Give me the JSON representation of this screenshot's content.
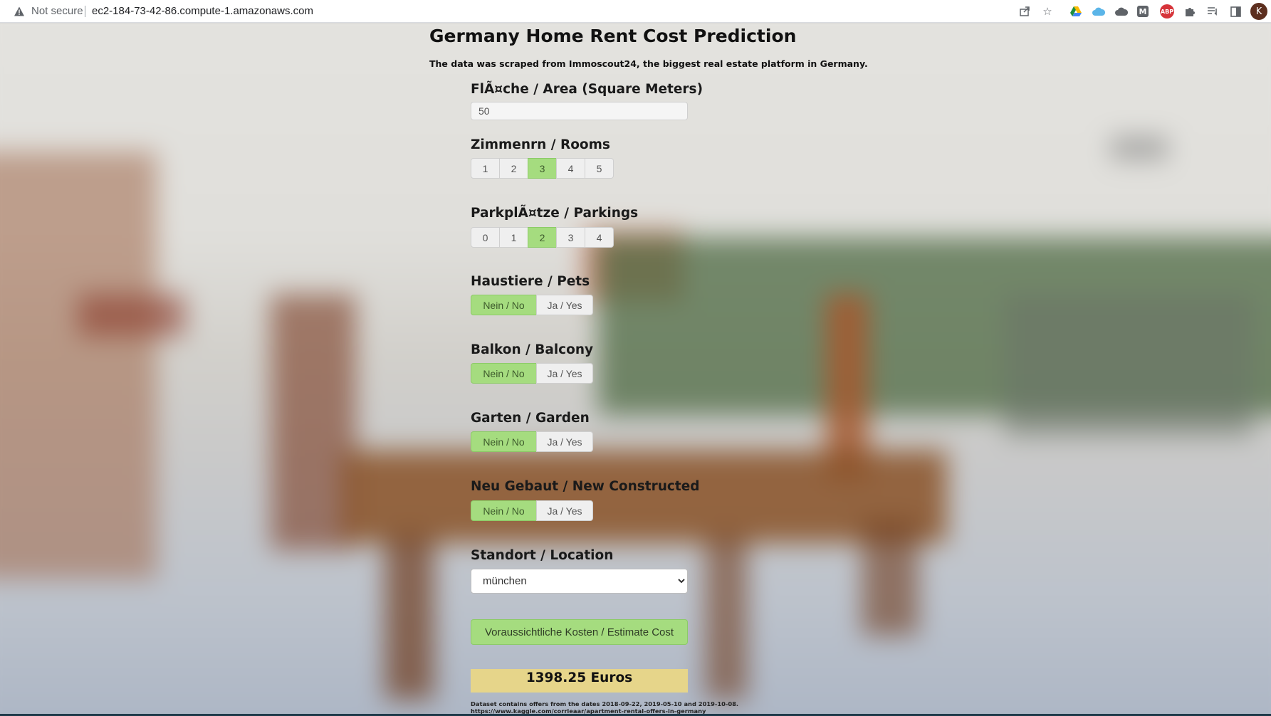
{
  "browser": {
    "security_label": "Not secure",
    "url": "ec2-184-73-42-86.compute-1.amazonaws.com",
    "extension_m_label": "M",
    "extension_abp_label": "ABP",
    "profile_initial": "K"
  },
  "page": {
    "title": "Germany Home Rent Cost Prediction",
    "subtitle": "The data was scraped from Immoscout24, the biggest real estate platform in Germany."
  },
  "form": {
    "area": {
      "label": "FlÃ¤che / Area (Square Meters)",
      "value": "50"
    },
    "rooms": {
      "label": "Zimmenrn / Rooms",
      "options": [
        "1",
        "2",
        "3",
        "4",
        "5"
      ],
      "selected": "3"
    },
    "parkings": {
      "label": "ParkplÃ¤tze / Parkings",
      "options": [
        "0",
        "1",
        "2",
        "3",
        "4"
      ],
      "selected": "2"
    },
    "pets": {
      "label": "Haustiere / Pets",
      "no": "Nein / No",
      "yes": "Ja / Yes",
      "selected": "no"
    },
    "balcony": {
      "label": "Balkon / Balcony",
      "no": "Nein / No",
      "yes": "Ja / Yes",
      "selected": "no"
    },
    "garden": {
      "label": "Garten / Garden",
      "no": "Nein / No",
      "yes": "Ja / Yes",
      "selected": "no"
    },
    "new_constructed": {
      "label": "Neu Gebaut / New Constructed",
      "no": "Nein / No",
      "yes": "Ja / Yes",
      "selected": "no"
    },
    "location": {
      "label": "Standort / Location",
      "selected": "münchen"
    },
    "estimate_button": "Voraussichtliche Kosten / Estimate Cost"
  },
  "result": {
    "value": "1398.25 Euros"
  },
  "footnote": {
    "line1": "Dataset contains offers from the dates 2018-09-22, 2019-05-10 and 2019-10-08.",
    "line2": "https://www.kaggle.com/corrieaar/apartment-rental-offers-in-germany"
  },
  "colors": {
    "active_green": "#a5dc7f",
    "result_yellow": "#e6d58a"
  }
}
